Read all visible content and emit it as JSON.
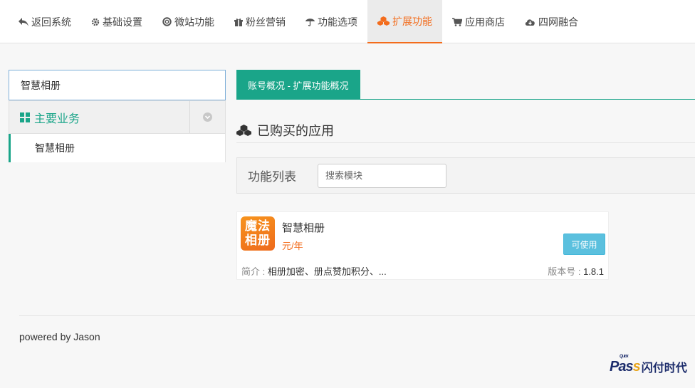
{
  "nav": {
    "items": [
      {
        "label": "返回系统",
        "icon": "reply-icon"
      },
      {
        "label": "基础设置",
        "icon": "gear-icon"
      },
      {
        "label": "微站功能",
        "icon": "lifebuoy-icon"
      },
      {
        "label": "粉丝营销",
        "icon": "gift-icon"
      },
      {
        "label": "功能选项",
        "icon": "umbrella-icon"
      },
      {
        "label": "扩展功能",
        "icon": "cubes-icon"
      },
      {
        "label": "应用商店",
        "icon": "cart-icon"
      },
      {
        "label": "四网融合",
        "icon": "cloud-download-icon"
      }
    ],
    "active_index": 5,
    "active_color": "#f36c1c"
  },
  "sidebar": {
    "search_value": "智慧相册",
    "group_label": "主要业务",
    "sub_item": "智慧相册",
    "accent": "#1aa589"
  },
  "main": {
    "tab_label": "账号概况 - 扩展功能概况",
    "section_title": "已购买的应用",
    "list_title": "功能列表",
    "module_search_placeholder": "搜索模块"
  },
  "app": {
    "logo_text_line1": "魔法",
    "logo_text_line2": "相册",
    "name": "智慧相册",
    "price": "元/年",
    "button_label": "可使用",
    "desc_label": "简介 : ",
    "desc_value": "相册加密、册点赞加积分、...",
    "version_label": "版本号 : ",
    "version_value": "1.8.1"
  },
  "footer": {
    "text": "powered by Jason"
  },
  "brand": {
    "quick": "Quick",
    "pass_a": "Pas",
    "pass_b": "s",
    "cn": "闪付时代"
  }
}
